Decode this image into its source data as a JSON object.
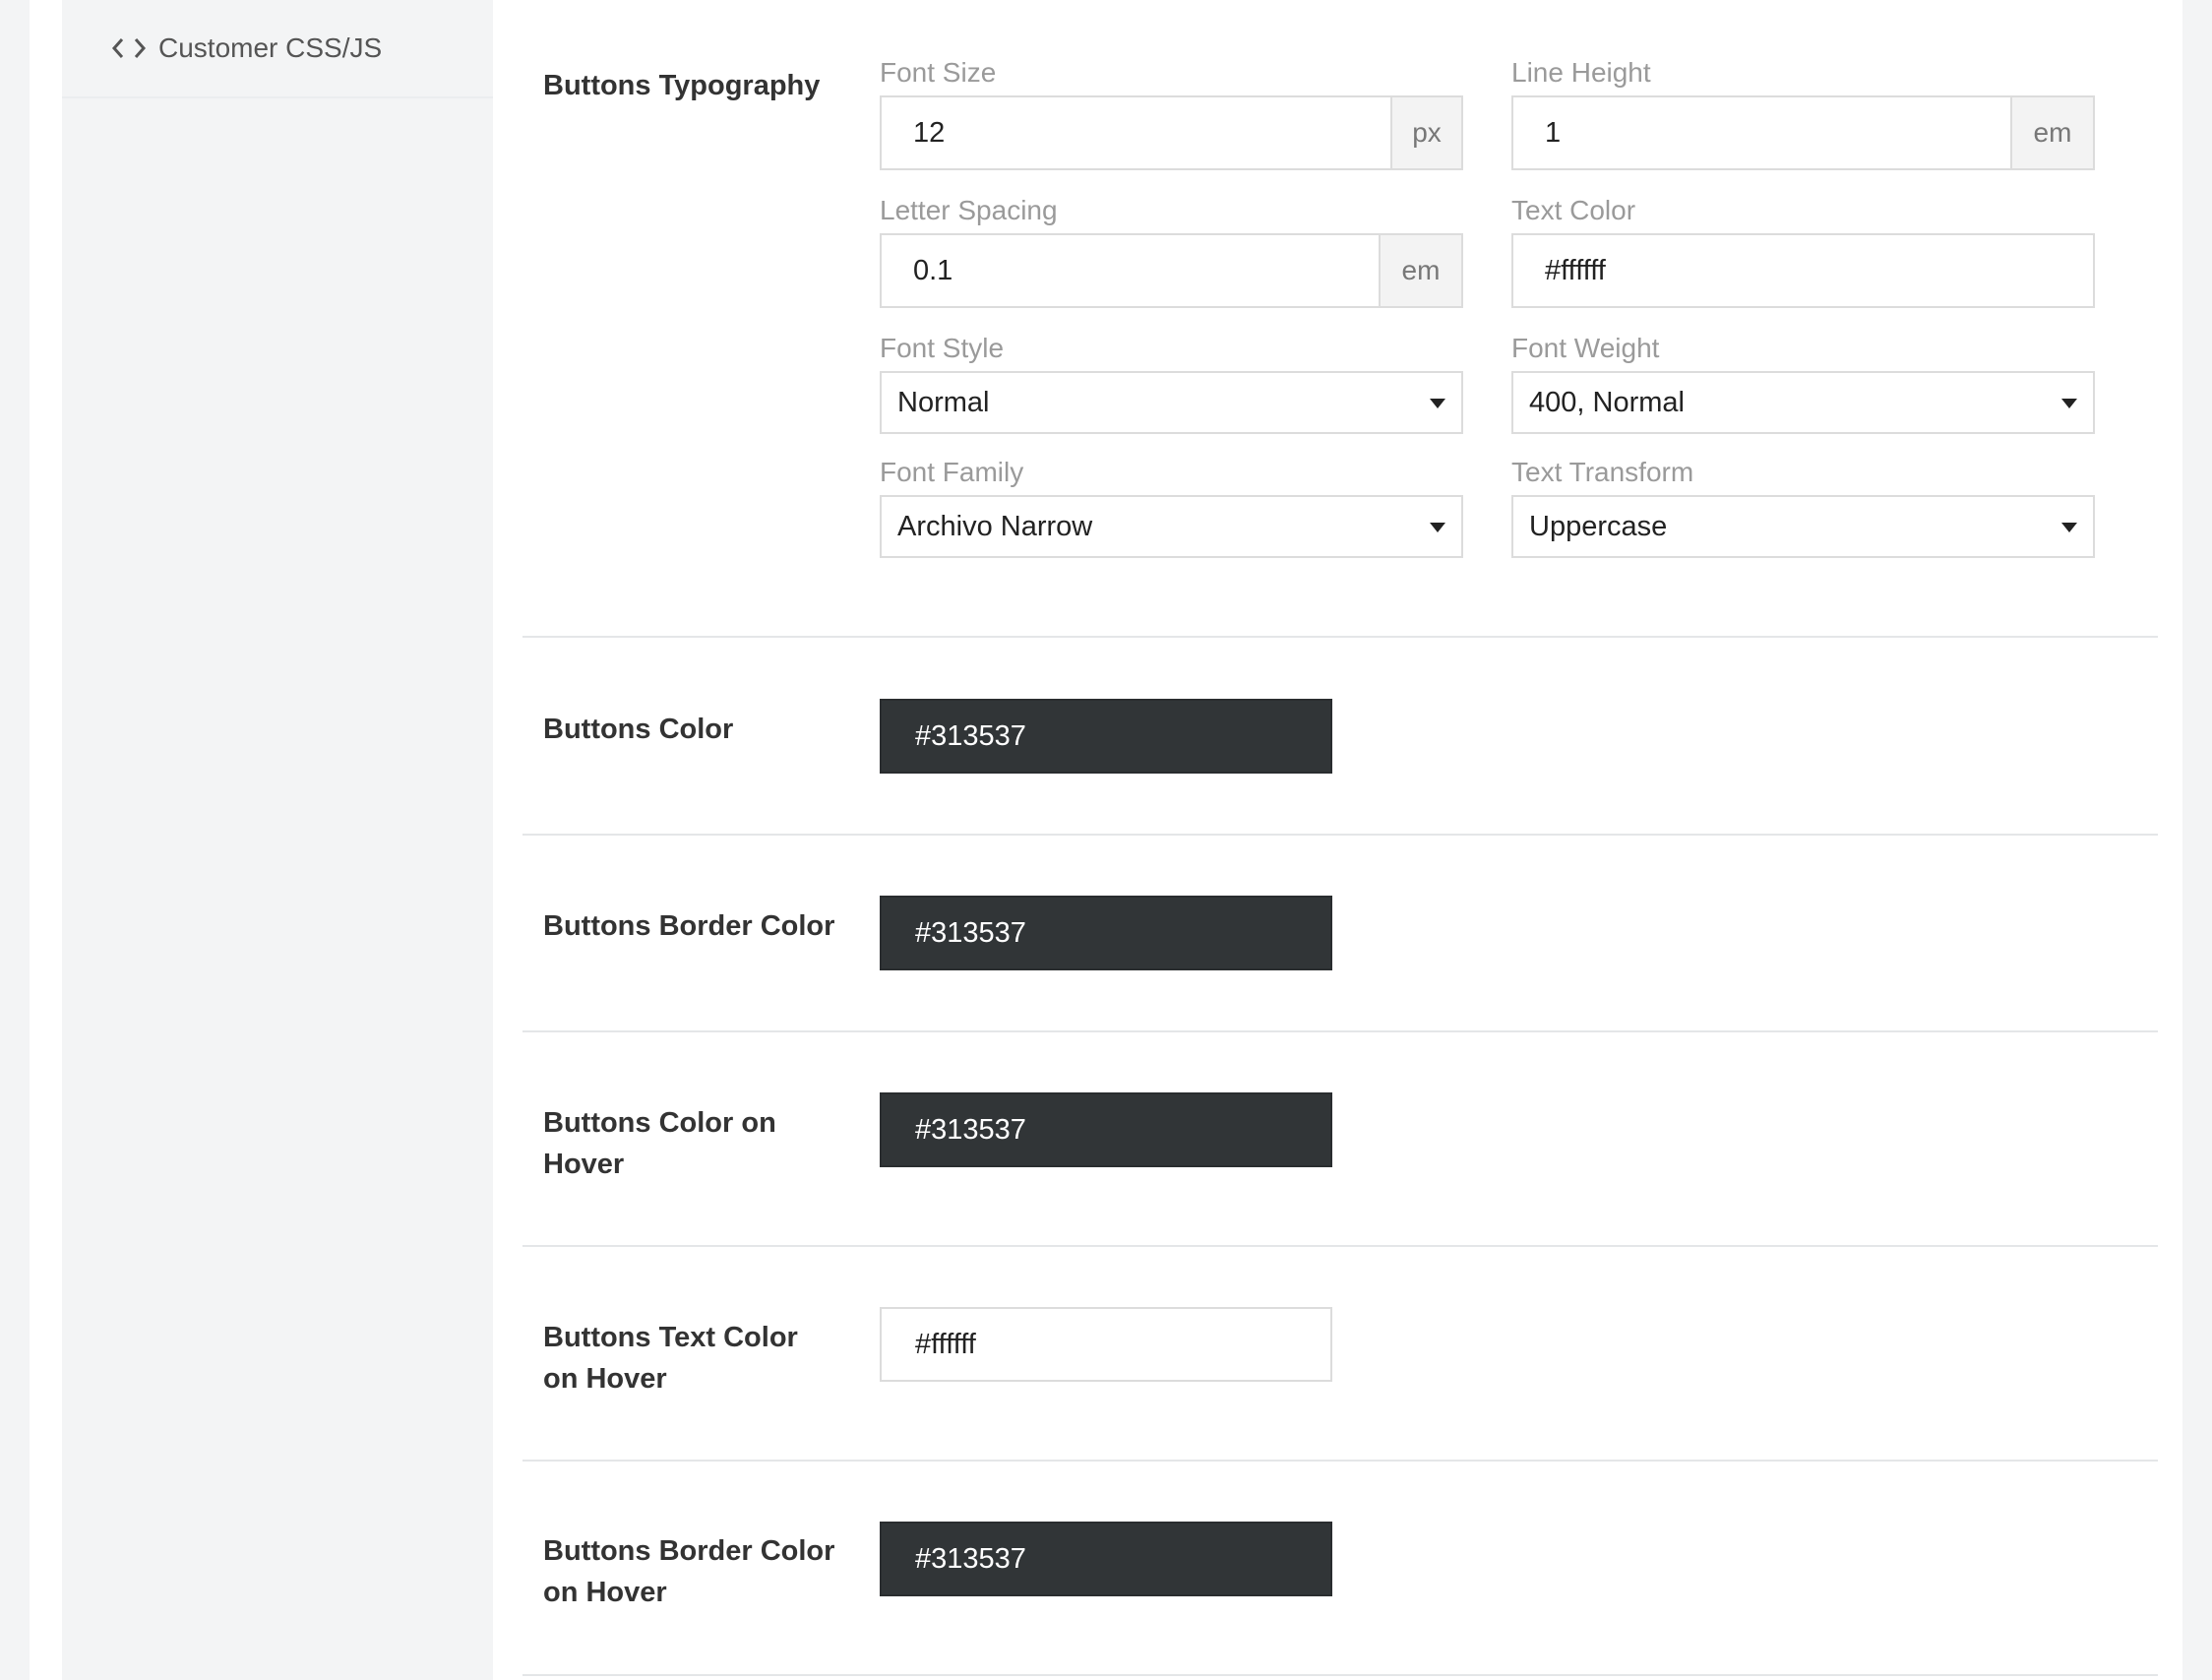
{
  "sidebar": {
    "items": [
      {
        "label": "Customer CSS/JS",
        "icon": "code-icon"
      }
    ]
  },
  "typography": {
    "title": "Buttons Typography",
    "font_size": {
      "label": "Font Size",
      "value": "12",
      "unit": "px"
    },
    "line_height": {
      "label": "Line Height",
      "value": "1",
      "unit": "em"
    },
    "letter_spacing": {
      "label": "Letter Spacing",
      "value": "0.1",
      "unit": "em"
    },
    "text_color": {
      "label": "Text Color",
      "value": "#ffffff"
    },
    "font_style": {
      "label": "Font Style",
      "value": "Normal"
    },
    "font_weight": {
      "label": "Font Weight",
      "value": "400, Normal"
    },
    "font_family": {
      "label": "Font Family",
      "value": "Archivo Narrow"
    },
    "text_transform": {
      "label": "Text Transform",
      "value": "Uppercase"
    }
  },
  "color_rows": [
    {
      "label": "Buttons Color",
      "value": "#313537"
    },
    {
      "label": "Buttons Border Color",
      "value": "#313537"
    },
    {
      "label": "Buttons Color on Hover",
      "value": "#313537"
    },
    {
      "label": "Buttons Text Color on Hover",
      "value": "#ffffff"
    },
    {
      "label": "Buttons Border Color on Hover",
      "value": "#313537"
    }
  ],
  "colors": {
    "swatch_dark": "#313537",
    "swatch_light": "#ffffff",
    "sidebar_bg": "#f3f4f5"
  }
}
